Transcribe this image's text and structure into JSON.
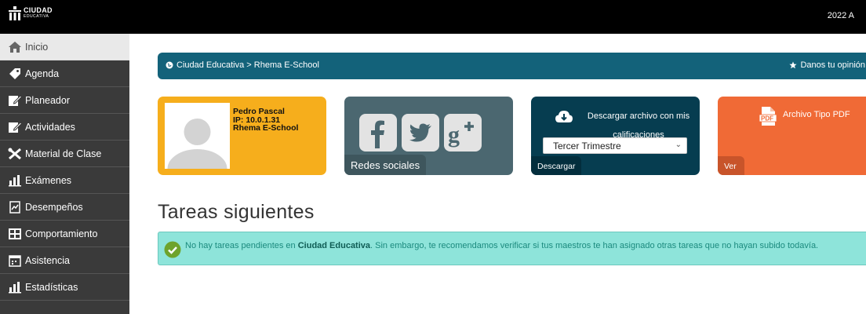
{
  "topbar": {
    "logo_line1": "CIUDAD",
    "logo_line2": "EDUCATIVA",
    "year": "2022 A"
  },
  "sidebar": {
    "items": [
      {
        "label": "Inicio",
        "icon": "home-icon"
      },
      {
        "label": "Agenda",
        "icon": "tag-icon"
      },
      {
        "label": "Planeador",
        "icon": "edit-icon"
      },
      {
        "label": "Actividades",
        "icon": "edit-icon"
      },
      {
        "label": "Material de Clase",
        "icon": "tools-icon"
      },
      {
        "label": "Exámenes",
        "icon": "chart-icon"
      },
      {
        "label": "Desempeños",
        "icon": "document-chart-icon"
      },
      {
        "label": "Comportamiento",
        "icon": "behavior-icon"
      },
      {
        "label": "Asistencia",
        "icon": "calendar-icon"
      },
      {
        "label": "Estadísticas",
        "icon": "chart-icon"
      }
    ]
  },
  "breadcrumb": {
    "text": "Ciudad Educativa > Rhema E-School",
    "opinion": "Danos tu opinión"
  },
  "profile": {
    "name": "Pedro Pascal",
    "ip": "IP: 10.0.1.31",
    "school": "Rhema E-School"
  },
  "social": {
    "label": "Redes sociales"
  },
  "download": {
    "title": "Descargar archivo con mis calificaciones",
    "selected": "Tercer Trimestre",
    "label": "Descargar"
  },
  "pdf": {
    "title": "Archivo Tipo PDF",
    "icon_text": "PDF",
    "label": "Ver"
  },
  "tasks": {
    "title": "Tareas siguientes",
    "notice_before": "No hay tareas pendientes en ",
    "notice_bold": "Ciudad Educativa",
    "notice_after": ". Sin embargo, te recomendamos verificar si tus maestros te han asignado otras tareas que no hayan subido todavía."
  },
  "colors": {
    "topbar": "#000000",
    "sidebar": "#3a3a3a",
    "breadcrumb": "#13627a",
    "profile_card": "#f6ae1c",
    "social_card": "#4b6770",
    "download_card": "#063d50",
    "pdf_card": "#f06a36",
    "notice_bg": "#8ee4da"
  }
}
